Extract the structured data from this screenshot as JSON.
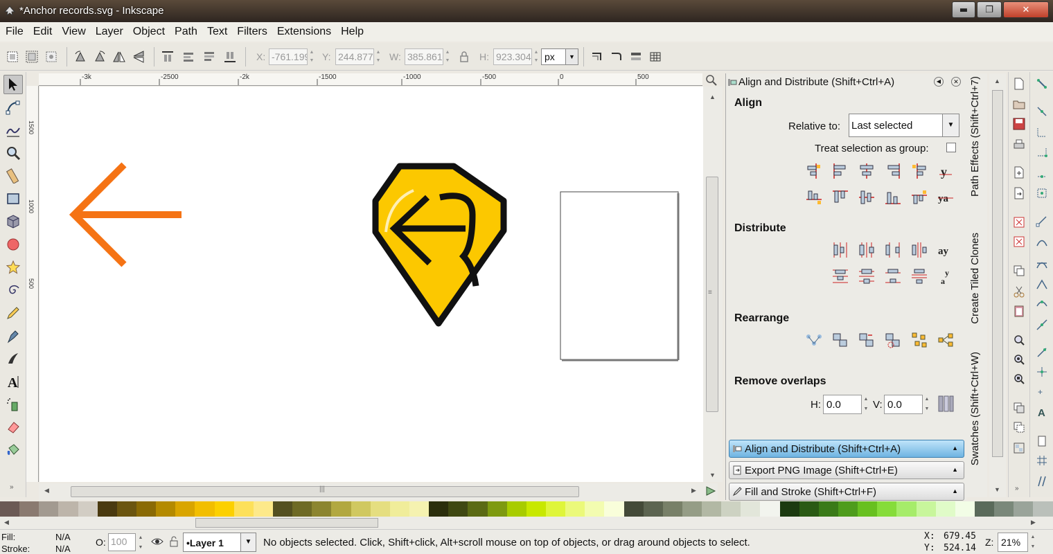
{
  "window": {
    "title": "*Anchor records.svg - Inkscape",
    "min_btn": "▬",
    "max_btn": "❐",
    "close_btn": "✕"
  },
  "menu": [
    "File",
    "Edit",
    "View",
    "Layer",
    "Object",
    "Path",
    "Text",
    "Filters",
    "Extensions",
    "Help"
  ],
  "toolctrl": {
    "x_label": "X:",
    "x_value": "-761.199",
    "y_label": "Y:",
    "y_value": "244.877",
    "w_label": "W:",
    "w_value": "385.861",
    "h_label": "H:",
    "h_value": "923.304",
    "unit": "px"
  },
  "ruler": {
    "h_labels": [
      "-3k",
      "-2500",
      "-2k",
      "-1500",
      "-1000",
      "-500",
      "0",
      "500"
    ],
    "v_labels": [
      "1500",
      "1000",
      "500"
    ]
  },
  "dock": {
    "title": "Align and Distribute (Shift+Ctrl+A)",
    "align_heading": "Align",
    "relative_label": "Relative to:",
    "relative_value": "Last selected",
    "treat_group_label": "Treat selection as group:",
    "distribute_heading": "Distribute",
    "rearrange_heading": "Rearrange",
    "remove_overlaps_heading": "Remove overlaps",
    "h_label": "H:",
    "h_value": "0.0",
    "v_label": "V:",
    "v_value": "0.0",
    "expanders": [
      "Align and Distribute (Shift+Ctrl+A)",
      "Export PNG Image (Shift+Ctrl+E)",
      "Fill and Stroke (Shift+Ctrl+F)"
    ],
    "side_tabs": [
      "Path Effects  (Shift+Ctrl+7)",
      "Create Tiled Clones",
      "Swatches (Shift+Ctrl+W)"
    ]
  },
  "palette": [
    "#6b5a55",
    "#8a7a70",
    "#a29a90",
    "#bdb5aa",
    "#d2cdc4",
    "#4a3a10",
    "#6b5510",
    "#8a6a05",
    "#b48a00",
    "#d9a500",
    "#f2be00",
    "#fcd000",
    "#fde05a",
    "#fde98a",
    "#545020",
    "#6e6a25",
    "#8c8530",
    "#b2a840",
    "#d0c860",
    "#e5de80",
    "#f0ed9a",
    "#f5f2b0",
    "#2b2e0c",
    "#3f4812",
    "#5b6a14",
    "#7e9a10",
    "#a8cc00",
    "#c8e800",
    "#dff53a",
    "#ebf97a",
    "#f3fcb0",
    "#f9feda",
    "#444a38",
    "#5c6450",
    "#788068",
    "#959d86",
    "#b2b8a4",
    "#cdd2c2",
    "#e2e6da",
    "#f2f4ee",
    "#1c3a10",
    "#2a5a14",
    "#3a7a18",
    "#4e9c1c",
    "#68c020",
    "#86dc3a",
    "#a6ec6a",
    "#c8f69c",
    "#e0fbc8",
    "#f2fde6",
    "#5a6a5a",
    "#7a887a",
    "#9aa49a",
    "#bac0ba"
  ],
  "status": {
    "fill_label": "Fill:",
    "fill_value": "N/A",
    "stroke_label": "Stroke:",
    "stroke_value": "N/A",
    "opacity_label": "O:",
    "opacity_value": "100",
    "layer": "•Layer 1",
    "message": "No objects selected. Click, Shift+click, Alt+scroll mouse on top of objects, or drag around objects to select.",
    "x_label": "X:",
    "x_value": "679.45",
    "y_label": "Y:",
    "y_value": "524.14",
    "zoom_label": "Z:",
    "zoom_value": "21%"
  },
  "colors": {
    "arrow": "#f57314",
    "shield": "#fcc800",
    "accent": "#6fb4e2"
  }
}
